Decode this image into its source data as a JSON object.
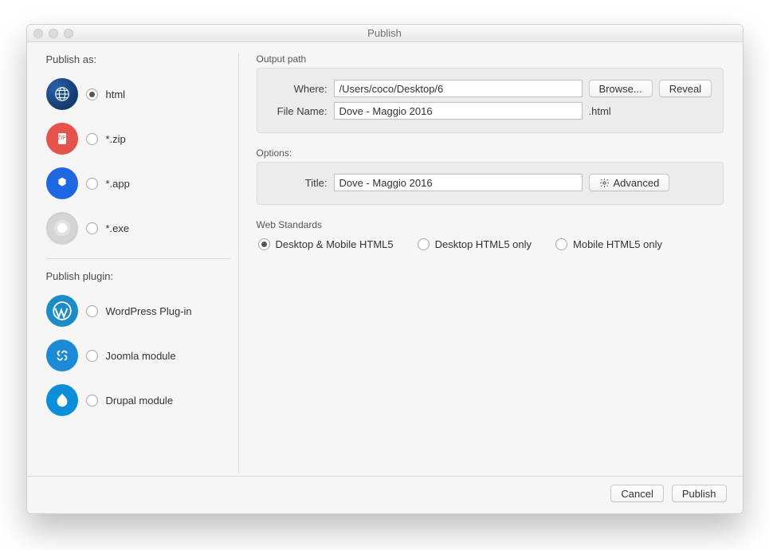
{
  "window": {
    "title": "Publish"
  },
  "left": {
    "section1_title": "Publish as:",
    "section2_title": "Publish plugin:",
    "formats": [
      {
        "label": "html",
        "selected": true
      },
      {
        "label": "*.zip",
        "selected": false
      },
      {
        "label": "*.app",
        "selected": false
      },
      {
        "label": "*.exe",
        "selected": false
      }
    ],
    "plugins": [
      {
        "label": "WordPress Plug-in"
      },
      {
        "label": "Joomla module"
      },
      {
        "label": "Drupal module"
      }
    ]
  },
  "output": {
    "legend": "Output path",
    "where_label": "Where:",
    "where_value": "/Users/coco/Desktop/6",
    "filename_label": "File Name:",
    "filename_value": "Dove - Maggio 2016",
    "ext": ".html",
    "browse_label": "Browse...",
    "reveal_label": "Reveal"
  },
  "options": {
    "legend": "Options:",
    "title_label": "Title:",
    "title_value": "Dove - Maggio 2016",
    "advanced_label": "Advanced"
  },
  "web_standards": {
    "legend": "Web Standards",
    "choices": [
      {
        "label": "Desktop & Mobile HTML5",
        "selected": true
      },
      {
        "label": "Desktop HTML5 only",
        "selected": false
      },
      {
        "label": "Mobile HTML5 only",
        "selected": false
      }
    ]
  },
  "footer": {
    "cancel_label": "Cancel",
    "publish_label": "Publish"
  }
}
